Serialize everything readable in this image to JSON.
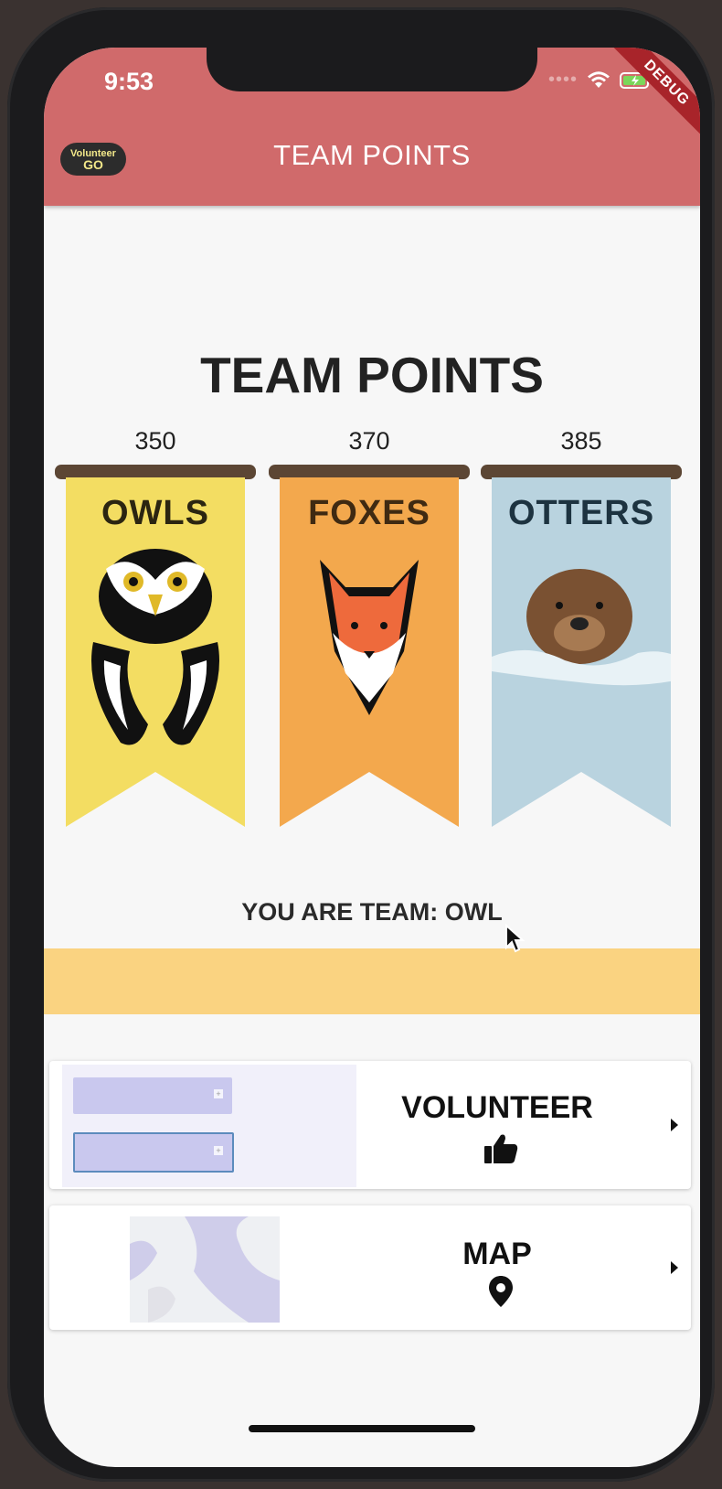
{
  "status_bar": {
    "time": "9:53",
    "debug_label": "DEBUG"
  },
  "app_bar": {
    "logo_text": "Volunteer",
    "logo_subtext": "GO",
    "title": "TEAM POINTS"
  },
  "main": {
    "heading": "TEAM POINTS",
    "teams": [
      {
        "name": "OWLS",
        "points": "350",
        "color": "#f3dd62",
        "text_color": "#2b2511",
        "mascot": "owl-icon"
      },
      {
        "name": "FOXES",
        "points": "370",
        "color": "#f3a84d",
        "text_color": "#3f2a12",
        "mascot": "fox-icon"
      },
      {
        "name": "OTTERS",
        "points": "385",
        "color": "#b9d3df",
        "text_color": "#1d3340",
        "mascot": "otter-icon"
      }
    ],
    "your_team": "YOU ARE TEAM: OWL"
  },
  "cards": [
    {
      "label": "VOLUNTEER",
      "icon": "thumbs-up-icon"
    },
    {
      "label": "MAP",
      "icon": "map-pin-icon"
    }
  ],
  "colors": {
    "app_bar": "#d06a6b",
    "highlight_bar": "#fad381",
    "background": "#f7f7f7"
  }
}
